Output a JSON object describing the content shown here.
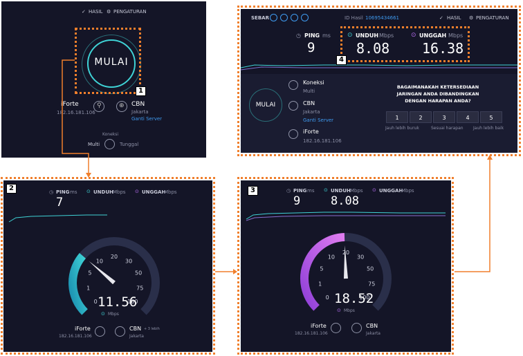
{
  "p1": {
    "nav_results": "HASIL",
    "nav_settings": "PENGATURAN",
    "go_button": "MULAI",
    "isp_name": "iForte",
    "isp_ip": "182.16.181.106",
    "server_name": "CBN",
    "server_city": "Jakarta",
    "change_server": "Ganti Server",
    "conn_label": "Koneksi",
    "conn_multi": "Multi",
    "conn_single": "Tunggal",
    "badge": "1"
  },
  "p2": {
    "badge": "2",
    "ping_label": "PING",
    "ping_unit": "ms",
    "down_label": "UNDUH",
    "down_unit": "Mbps",
    "up_label": "UNGGAH",
    "up_unit": "Mbps",
    "ping_value": "7",
    "speed_value": "11.56",
    "speed_unit": "Mbps",
    "gauge_fill": 0.317,
    "needle_fraction": 0.317,
    "ticks": [
      "0",
      "1",
      "5",
      "10",
      "20",
      "30",
      "50",
      "75",
      "100"
    ],
    "isp_name": "iForte",
    "isp_ip": "182.16.181.106",
    "server_name": "CBN",
    "server_extra": "+ 3 lebih",
    "server_city": "Jakarta"
  },
  "p3": {
    "badge": "3",
    "ping_label": "PING",
    "ping_unit": "ms",
    "down_label": "UNDUH",
    "down_unit": "Mbps",
    "up_label": "UNGGAH",
    "up_unit": "Mbps",
    "ping_value": "9",
    "down_value": "8.08",
    "speed_value": "18.52",
    "speed_unit": "Mbps",
    "gauge_fill": 0.493,
    "needle_fraction": 0.493,
    "ticks": [
      "0",
      "1",
      "5",
      "10",
      "20",
      "30",
      "50",
      "75",
      "100"
    ],
    "isp_name": "iForte",
    "isp_ip": "182.16.181.106",
    "server_name": "CBN",
    "server_city": "Jakarta"
  },
  "p4": {
    "badge": "4",
    "share_label": "SEBAR",
    "result_id_label": "ID Hasil",
    "result_id": "10695434661",
    "nav_results": "HASIL",
    "nav_settings": "PENGATURAN",
    "ping_label": "PING",
    "ping_unit": "ms",
    "ping_value": "9",
    "down_label": "UNDUH",
    "down_unit": "Mbps",
    "down_value": "8.08",
    "up_label": "UNGGAH",
    "up_unit": "Mbps",
    "up_value": "16.38",
    "go_button": "MULAI",
    "conn_label": "Koneksi",
    "conn_value": "Multi",
    "server_name": "CBN",
    "server_city": "Jakarta",
    "change_server": "Ganti Server",
    "isp_name": "iForte",
    "isp_ip": "182.16.181.106",
    "question": "BAGAIMANAKAH KETERSEDIAAN JARINGAN ANDA DIBANDINGKAN DENGAN HARAPAN ANDA?",
    "ratings": [
      "1",
      "2",
      "3",
      "4",
      "5"
    ],
    "rating_low": "Jauh lebih buruk",
    "rating_mid": "Sesuai harapan",
    "rating_high": "Jauh lebih baik"
  },
  "colors": {
    "panel_bg": "#141527",
    "accent_orange": "#f07f2c",
    "download_teal": "#3fd3d6",
    "upload_purple": "#b66df0",
    "link_blue": "#3f9bf0"
  }
}
